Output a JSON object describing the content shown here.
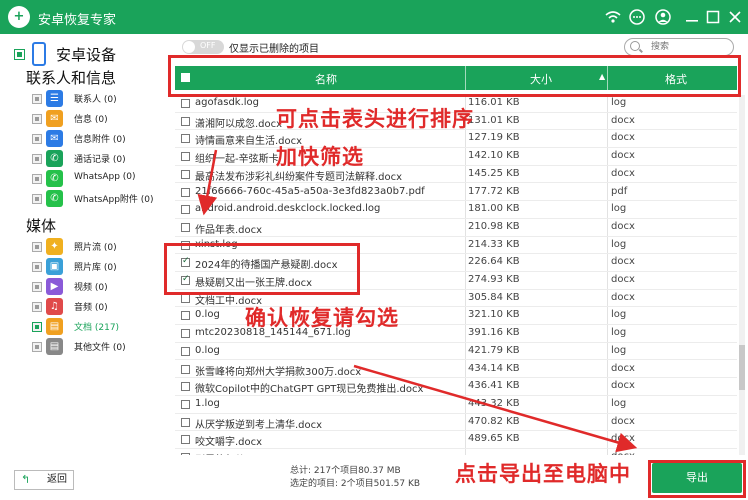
{
  "app": {
    "title": "安卓恢复专家"
  },
  "sidebar": {
    "device_label": "安卓设备",
    "sections": [
      {
        "title": "联系人和信息",
        "items": [
          {
            "label": "联系人 (0)",
            "icon": "contacts-icon",
            "color": "#2c7be5",
            "glyph": "☰",
            "checked": false
          },
          {
            "label": "信息 (0)",
            "icon": "message-icon",
            "color": "#f0a020",
            "glyph": "✉",
            "checked": false
          },
          {
            "label": "信息附件 (0)",
            "icon": "attachment-icon",
            "color": "#2c7be5",
            "glyph": "✉",
            "checked": false
          },
          {
            "label": "通话记录 (0)",
            "icon": "phone-icon",
            "color": "#1aa35a",
            "glyph": "✆",
            "checked": false
          },
          {
            "label": "WhatsApp (0)",
            "icon": "whatsapp-icon",
            "color": "#25c14a",
            "glyph": "✆",
            "checked": false
          },
          {
            "label": "WhatsApp附件 (0)",
            "icon": "whatsapp-attachment-icon",
            "color": "#25c14a",
            "glyph": "✆",
            "checked": false
          }
        ]
      },
      {
        "title": "媒体",
        "items": [
          {
            "label": "照片流 (0)",
            "icon": "photo-stream-icon",
            "color": "#f0b020",
            "glyph": "✦",
            "checked": false
          },
          {
            "label": "照片库 (0)",
            "icon": "photo-library-icon",
            "color": "#3aa0d8",
            "glyph": "▣",
            "checked": false
          },
          {
            "label": "视频 (0)",
            "icon": "video-icon",
            "color": "#8a5ad8",
            "glyph": "▶",
            "checked": false
          },
          {
            "label": "音频 (0)",
            "icon": "audio-icon",
            "color": "#e04a4a",
            "glyph": "♫",
            "checked": false
          },
          {
            "label": "文档 (217)",
            "icon": "document-icon",
            "color": "#f0a020",
            "glyph": "▤",
            "checked": true
          },
          {
            "label": "其他文件 (0)",
            "icon": "other-files-icon",
            "color": "#888888",
            "glyph": "▤",
            "checked": false
          }
        ]
      }
    ],
    "back_label": "返回"
  },
  "toolbar": {
    "toggle_text": "OFF",
    "toggle_label": "仅显示已删除的项目",
    "search_placeholder": "搜索"
  },
  "table": {
    "columns": [
      "名称",
      "大小",
      "格式"
    ],
    "rows": [
      {
        "name": "agofasdk.log",
        "size": "116.01 KB",
        "format": "log",
        "checked": false
      },
      {
        "name": "潇湘阿以成忽.docx",
        "size": "131.01 KB",
        "format": "docx",
        "checked": false
      },
      {
        "name": "诗情画意来自生活.docx",
        "size": "127.19 KB",
        "format": "docx",
        "checked": false
      },
      {
        "name": "组织一起-辛弦斯卡",
        "size": "142.10 KB",
        "format": "docx",
        "checked": false
      },
      {
        "name": "最高法发布涉彩礼纠纷案件专题司法解释.docx",
        "size": "145.25 KB",
        "format": "docx",
        "checked": false
      },
      {
        "name": "21f66666-760c-45a5-a50a-3e3fd823a0b7.pdf",
        "size": "177.72 KB",
        "format": "pdf",
        "checked": false
      },
      {
        "name": "android.android.deskclock.locked.log",
        "size": "181.00 KB",
        "format": "log",
        "checked": false
      },
      {
        "name": "作品年表.docx",
        "size": "210.98 KB",
        "format": "docx",
        "checked": false
      },
      {
        "name": "xinst.log",
        "size": "214.33 KB",
        "format": "log",
        "checked": false
      },
      {
        "name": "2024年的待播国产悬疑剧.docx",
        "size": "226.64 KB",
        "format": "docx",
        "checked": true
      },
      {
        "name": "悬疑剧又出一张王牌.docx",
        "size": "274.93 KB",
        "format": "docx",
        "checked": true
      },
      {
        "name": "文档工中.docx",
        "size": "305.84 KB",
        "format": "docx",
        "checked": false
      },
      {
        "name": "0.log",
        "size": "321.10 KB",
        "format": "log",
        "checked": false
      },
      {
        "name": "mtc20230818_145144_671.log",
        "size": "391.16 KB",
        "format": "log",
        "checked": false
      },
      {
        "name": "0.log",
        "size": "421.79 KB",
        "format": "log",
        "checked": false
      },
      {
        "name": "张雪峰将向郑州大学捐款300万.docx",
        "size": "434.14 KB",
        "format": "docx",
        "checked": false
      },
      {
        "name": "微软Copilot中的ChatGPT GPT现已免费推出.docx",
        "size": "436.41 KB",
        "format": "docx",
        "checked": false
      },
      {
        "name": "1.log",
        "size": "443.32 KB",
        "format": "log",
        "checked": false
      },
      {
        "name": "从厌学叛逆到考上清华.docx",
        "size": "470.82 KB",
        "format": "docx",
        "checked": false
      },
      {
        "name": "咬文嚼字.docx",
        "size": "489.65 KB",
        "format": "docx",
        "checked": false
      },
      {
        "name": "剧里的年儿.docx",
        "size": "",
        "format": "docx",
        "checked": false
      }
    ]
  },
  "footer": {
    "total": "总计: 217个项目80.37 MB",
    "selected": "选定的项目: 2个项目501.57 KB",
    "export_label": "导出"
  },
  "annotations": {
    "sort_hint": "可点击表头进行排序",
    "filter_hint": "加快筛选",
    "check_hint": "确认恢复请勾选",
    "export_hint": "点击导出至电脑中"
  },
  "colors": {
    "accent": "#1aa35a",
    "annotation": "#e02a2a"
  }
}
